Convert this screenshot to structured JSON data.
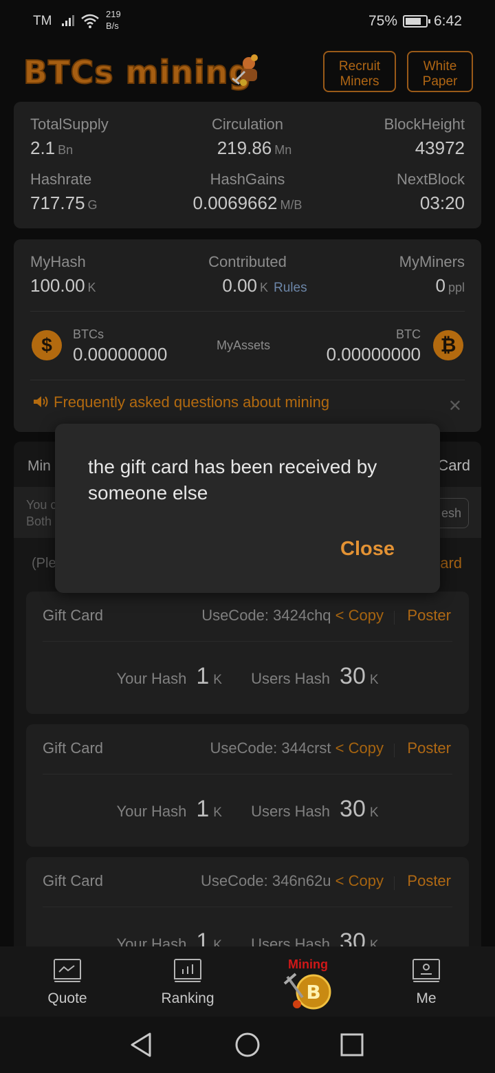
{
  "status_bar": {
    "carrier": "TM",
    "speed_value": "219",
    "speed_unit": "B/s",
    "battery": "75%",
    "time": "6:42"
  },
  "header": {
    "logo_text": "BTCs mining",
    "recruit_line1": "Recruit",
    "recruit_line2": "Miners",
    "paper_line1": "White",
    "paper_line2": "Paper"
  },
  "stats": {
    "total_supply": {
      "label": "TotalSupply",
      "value": "2.1",
      "unit": "Bn"
    },
    "circulation": {
      "label": "Circulation",
      "value": "219.86",
      "unit": "Mn"
    },
    "block_height": {
      "label": "BlockHeight",
      "value": "43972"
    },
    "hashrate": {
      "label": "Hashrate",
      "value": "717.75",
      "unit": "G"
    },
    "hash_gains": {
      "label": "HashGains",
      "value": "0.0069662",
      "unit": "M/B"
    },
    "next_block": {
      "label": "NextBlock",
      "value": "03:20"
    }
  },
  "mine": {
    "my_hash": {
      "label": "MyHash",
      "value": "100.00",
      "unit": "K"
    },
    "contributed": {
      "label": "Contributed",
      "value": "0.00",
      "unit": "K",
      "rules": "Rules"
    },
    "my_miners": {
      "label": "MyMiners",
      "value": "0",
      "unit": "ppl"
    },
    "btcs": {
      "label": "BTCs",
      "value": "0.00000000",
      "symbol": "$"
    },
    "my_assets": "MyAssets",
    "btc": {
      "label": "BTC",
      "value": "0.00000000",
      "symbol": "₿"
    },
    "faq": "Frequently asked questions about mining"
  },
  "tabs_panel": {
    "tab_left": "Min",
    "tab_right": "Card",
    "note_line1": "You c",
    "note_line2": "Both",
    "refresh": "esh",
    "sub_note": "(Ple",
    "sub_link": "ard"
  },
  "gift_cards": [
    {
      "title": "Gift Card",
      "code_label": "UseCode: 3424chq",
      "copy": "< Copy",
      "poster": "Poster",
      "your_hash_label": "Your Hash",
      "your_hash": "1",
      "your_unit": "K",
      "users_hash_label": "Users Hash",
      "users_hash": "30",
      "users_unit": "K"
    },
    {
      "title": "Gift Card",
      "code_label": "UseCode: 344crst",
      "copy": "< Copy",
      "poster": "Poster",
      "your_hash_label": "Your Hash",
      "your_hash": "1",
      "your_unit": "K",
      "users_hash_label": "Users Hash",
      "users_hash": "30",
      "users_unit": "K"
    },
    {
      "title": "Gift Card",
      "code_label": "UseCode: 346n62u",
      "copy": "< Copy",
      "poster": "Poster",
      "your_hash_label": "Your Hash",
      "your_hash": "1",
      "your_unit": "K",
      "users_hash_label": "Users Hash",
      "users_hash": "30",
      "users_unit": "K"
    }
  ],
  "dialog": {
    "message": "the gift card has been received by someone else",
    "close": "Close"
  },
  "bottom_nav": {
    "quote": "Quote",
    "ranking": "Ranking",
    "mining": "Mining",
    "me": "Me"
  },
  "colors": {
    "accent": "#b36a0f",
    "dialog_button": "#e39234",
    "background": "#0c0c0c",
    "card": "#1f1f1f"
  }
}
